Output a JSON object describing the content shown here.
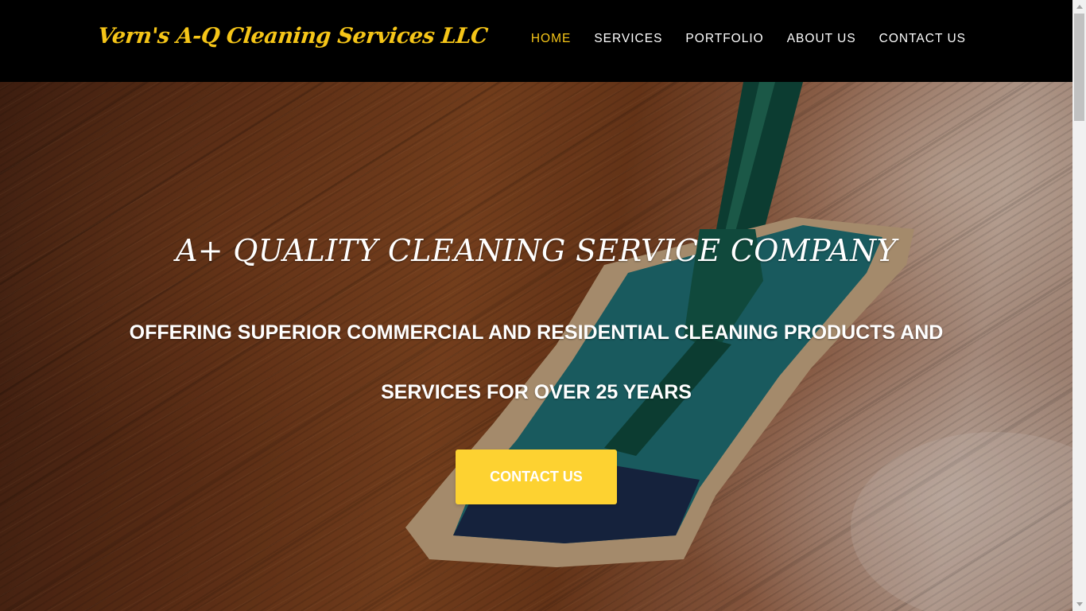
{
  "header": {
    "logo_text": "Vern's A-Q Cleaning Services LLC",
    "nav": {
      "home": "HOME",
      "services": "SERVICES",
      "portfolio": "PORTFOLIO",
      "about": "ABOUT US",
      "contact": "CONTACT US"
    },
    "active_item": "HOME"
  },
  "hero": {
    "headline": "A+ QUALITY CLEANING SERVICE COMPANY",
    "subheadline": "OFFERING SUPERIOR COMMERCIAL AND RESIDENTIAL CLEANING PRODUCTS AND SERVICES FOR OVER 25 YEARS",
    "cta_label": "CONTACT US"
  },
  "colors": {
    "header_bg": "#000000",
    "accent": "#f5c518",
    "cta_bg": "#fdd231",
    "text_light": "#ffffff"
  }
}
